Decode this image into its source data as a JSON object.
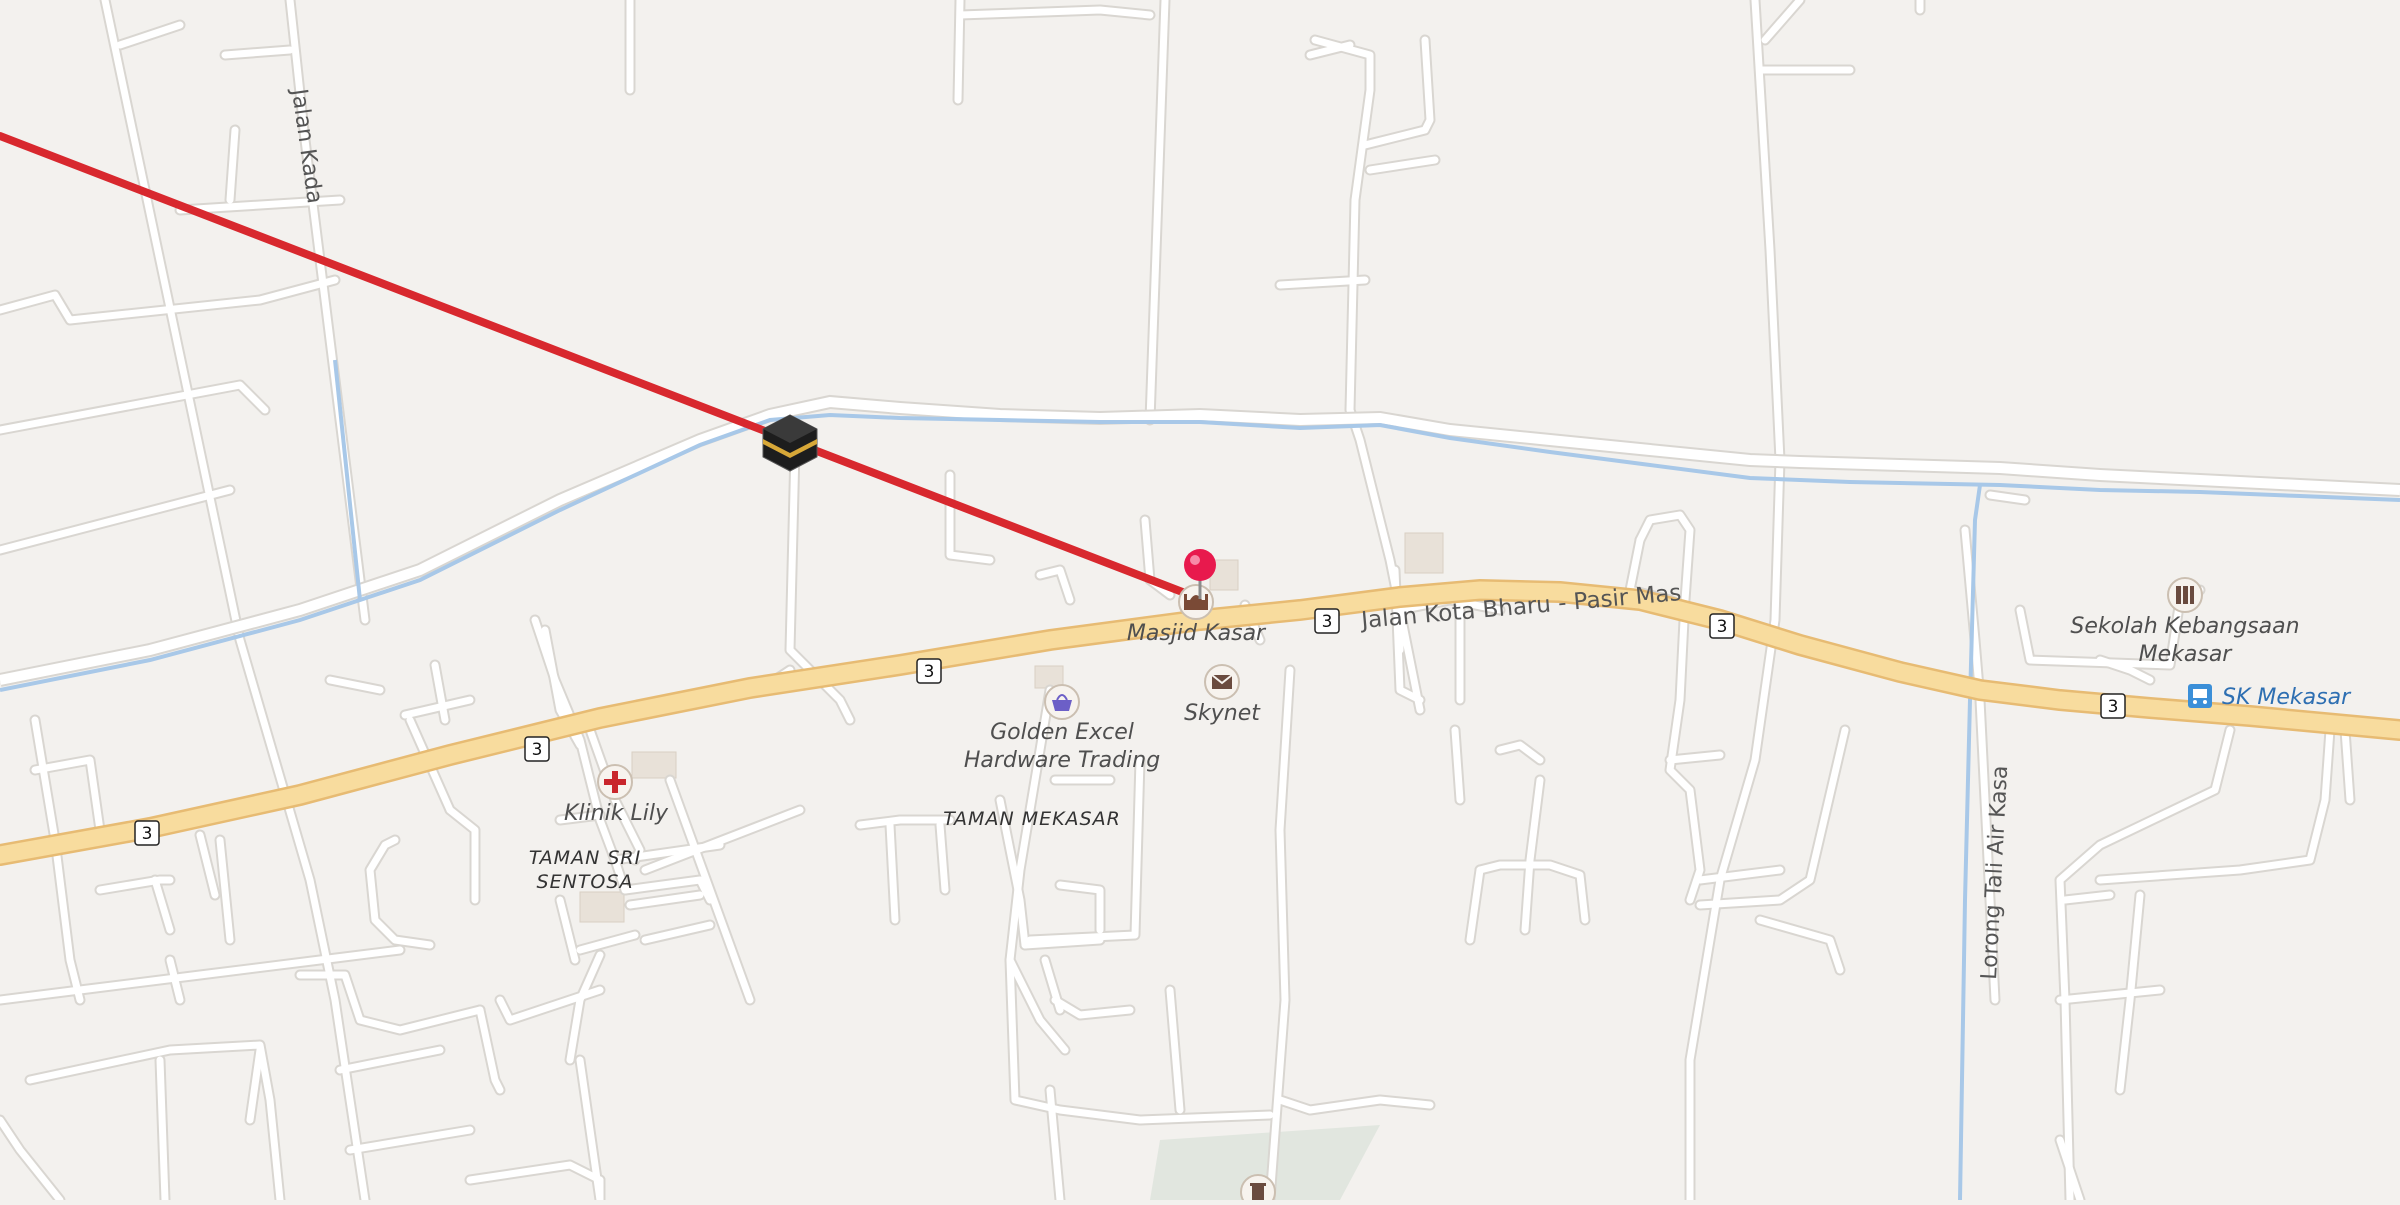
{
  "map": {
    "colors": {
      "background": "#f3f1ee",
      "minor_road": "#ffffff",
      "road_casing": "#d9d6d1",
      "primary_road": "#f8dc9e",
      "primary_casing": "#e7bb73",
      "waterway": "#a8c8e8",
      "qibla_line": "#d8282e",
      "pin": "#e8194d",
      "park": "#e0e4de",
      "bus_stop": "#3b8fd8"
    },
    "streets": {
      "jalan_kada": "Jalan Kada",
      "jalan_kota_bharu": "Jalan Kota Bharu - Pasir Mas",
      "lorong_tali_air": "Lorong Tali Air Kasa"
    },
    "route_number": "3",
    "areas": {
      "taman_sri_sentosa_line1": "TAMAN SRI",
      "taman_sri_sentosa_line2": "SENTOSA",
      "taman_mekasar": "TAMAN MEKASAR"
    },
    "pois": {
      "masjid": "Masjid Kasar",
      "skynet": "Skynet",
      "golden_line1": "Golden Excel",
      "golden_line2": "Hardware Trading",
      "klinik": "Klinik Lily",
      "sekolah_line1": "Sekolah Kebangsaan",
      "sekolah_line2": "Mekasar",
      "sk_mekasar": "SK Mekasar"
    },
    "icons": {
      "kaaba": "kaaba-icon",
      "pin": "location-pin-icon",
      "mosque": "mosque-icon",
      "mail": "mail-icon",
      "shop": "shopping-basket-icon",
      "clinic": "medical-cross-icon",
      "school": "school-icon",
      "bus": "bus-stop-icon",
      "waste": "waste-basket-icon"
    }
  }
}
